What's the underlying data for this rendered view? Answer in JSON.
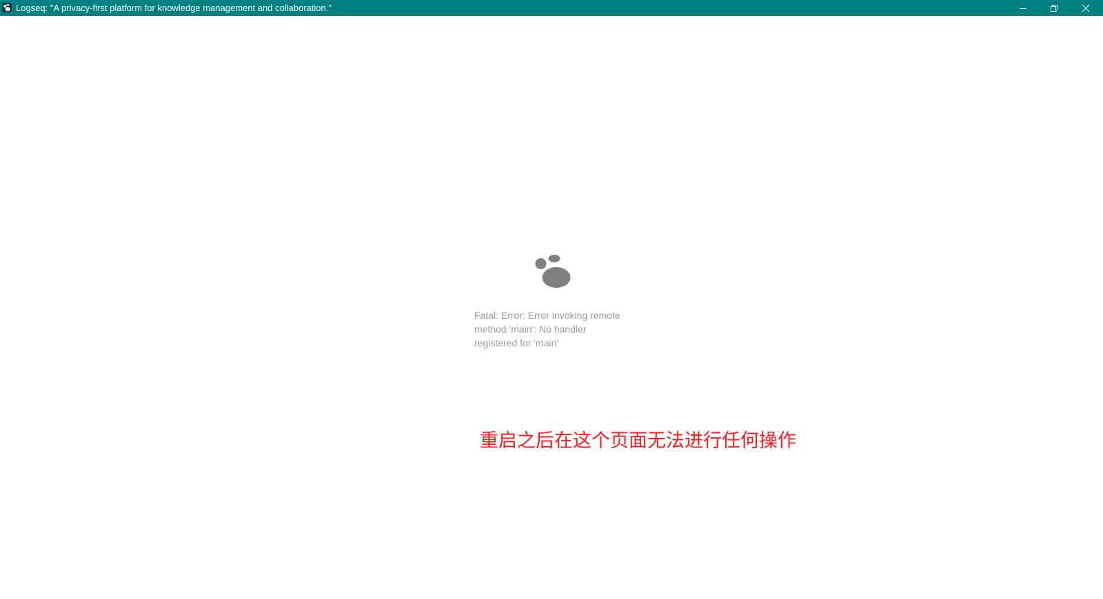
{
  "window": {
    "title": "Logseq: \"A privacy-first platform for knowledge management and collaboration.\"",
    "titlebar_color": "#008080",
    "title_text_color": "#ffffff",
    "app_icon": "logseq-logo-icon",
    "controls": {
      "minimize_icon": "minimize-icon",
      "restore_icon": "restore-icon",
      "close_icon": "close-icon"
    }
  },
  "main": {
    "logo_icon": "logseq-logo-icon",
    "logo_color": "#808080",
    "error_message": "Fatal: Error: Error invoking remote\nmethod 'main': No handler\nregistered for 'main'",
    "error_color": "#9b9b9b"
  },
  "annotation": {
    "text": "重启之后在这个页面无法进行任何操作",
    "color": "#ff1a1a"
  }
}
